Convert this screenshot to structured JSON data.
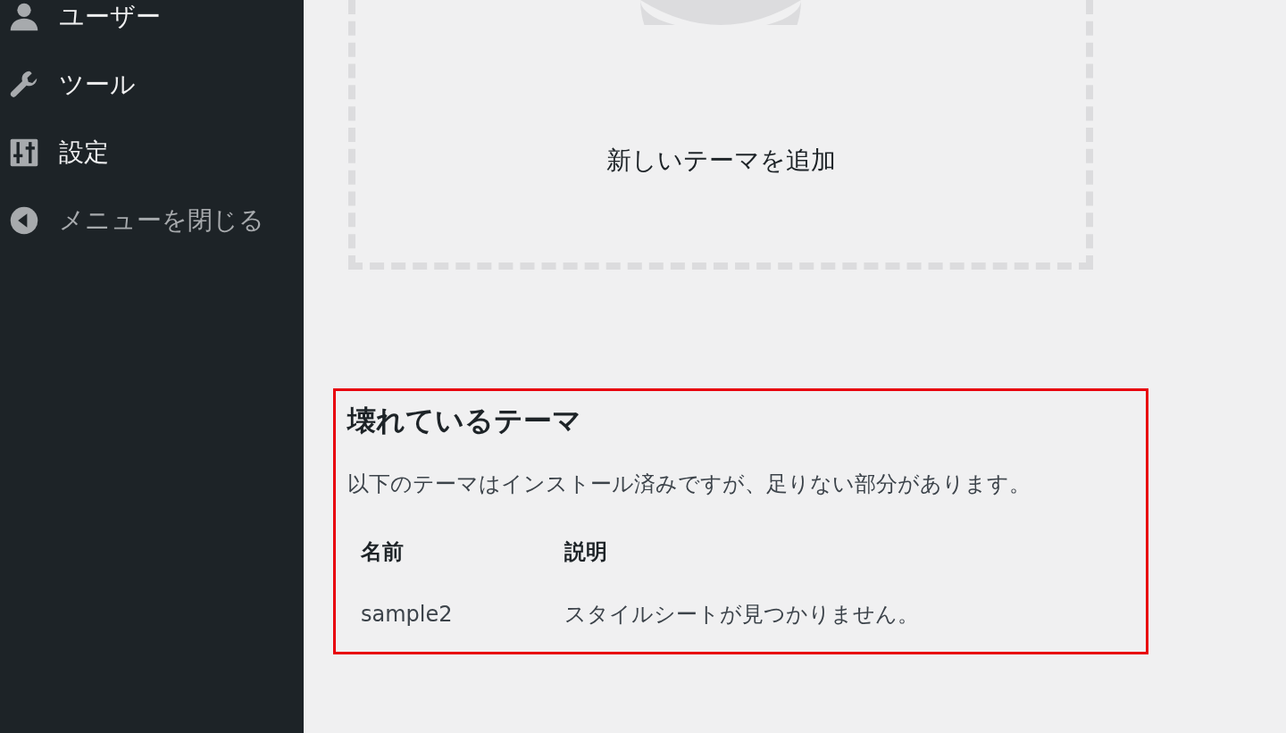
{
  "sidebar": {
    "items": [
      {
        "kind": "user",
        "label": "ユーザー"
      },
      {
        "kind": "tools",
        "label": "ツール"
      },
      {
        "kind": "settings",
        "label": "設定"
      },
      {
        "kind": "collapse",
        "label": "メニューを閉じる"
      }
    ]
  },
  "add_theme": {
    "label": "新しいテーマを追加"
  },
  "broken_themes": {
    "title": "壊れているテーマ",
    "description": "以下のテーマはインストール済みですが、足りない部分があります。",
    "table": {
      "columns": [
        "名前",
        "説明"
      ],
      "rows": [
        [
          "sample2",
          "スタイルシートが見つかりません。"
        ]
      ]
    }
  }
}
